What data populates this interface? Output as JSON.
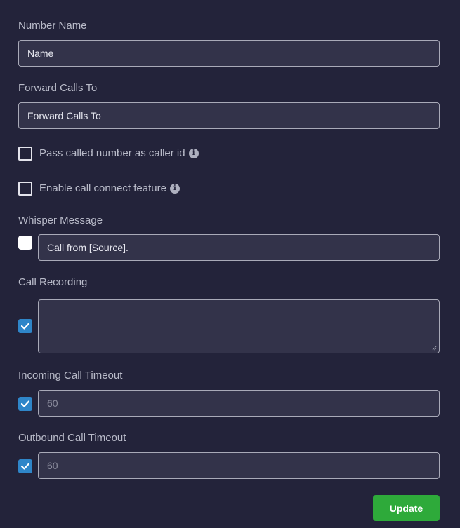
{
  "number_name": {
    "label": "Number Name",
    "value": "Name"
  },
  "forward_calls": {
    "label": "Forward Calls To",
    "value": "Forward Calls To"
  },
  "pass_caller_id": {
    "label": "Pass called number as caller id",
    "checked": false,
    "info_icon": "info-icon"
  },
  "call_connect": {
    "label": "Enable call connect feature",
    "checked": false,
    "info_icon": "info-icon"
  },
  "whisper": {
    "label": "Whisper Message",
    "checked": false,
    "value": "Call from [Source]."
  },
  "call_recording": {
    "label": "Call Recording",
    "checked": true,
    "value": ""
  },
  "incoming_timeout": {
    "label": "Incoming Call Timeout",
    "checked": true,
    "placeholder": "60"
  },
  "outbound_timeout": {
    "label": "Outbound Call Timeout",
    "checked": true,
    "placeholder": "60"
  },
  "update_button": {
    "label": "Update"
  },
  "colors": {
    "background": "#23233a",
    "input": "#33334a",
    "accent": "#2f86c9",
    "button": "#2eaa3a"
  }
}
